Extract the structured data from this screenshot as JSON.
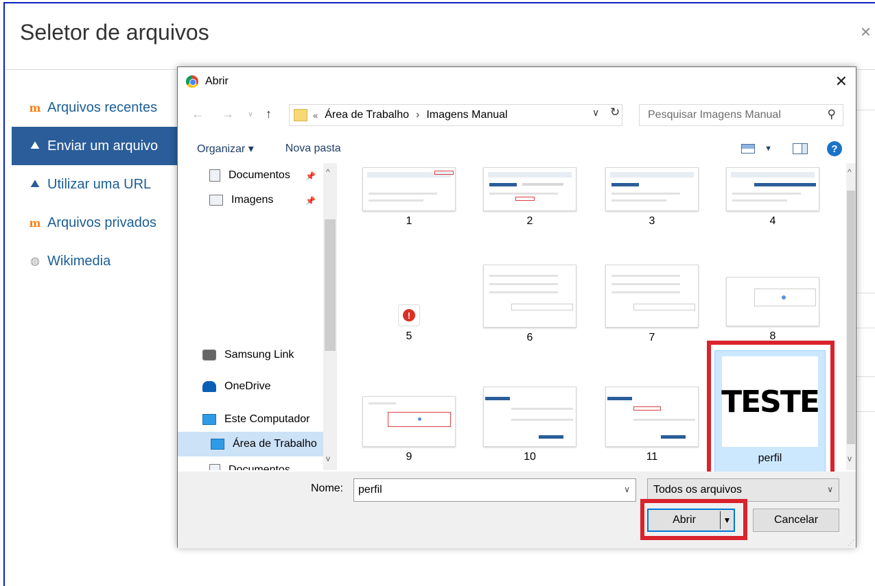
{
  "modal": {
    "title": "Seletor de arquivos",
    "close": "×"
  },
  "sidebar": {
    "items": [
      {
        "label": "Arquivos recentes",
        "icon": "moodle-icon"
      },
      {
        "label": "Enviar um arquivo",
        "icon": "upload-icon",
        "active": true
      },
      {
        "label": "Utilizar uma URL",
        "icon": "url-icon"
      },
      {
        "label": "Arquivos privados",
        "icon": "moodle-icon"
      },
      {
        "label": "Wikimedia",
        "icon": "wikimedia-icon"
      }
    ]
  },
  "dialog": {
    "title": "Abrir",
    "close": "✕",
    "path": {
      "prefix": "«",
      "crumbs": [
        "Área de Trabalho",
        "Imagens Manual"
      ],
      "separator": "›"
    },
    "search_placeholder": "Pesquisar Imagens Manual",
    "toolbar": {
      "organize": "Organizar ▾",
      "new_folder": "Nova pasta",
      "help": "?"
    },
    "nav": {
      "documents": "Documentos",
      "images": "Imagens",
      "samsung": "Samsung Link",
      "onedrive": "OneDrive",
      "computer": "Este Computador",
      "desktop": "Área de Trabalho",
      "documents2": "Documentos"
    },
    "files": [
      "1",
      "2",
      "3",
      "4",
      "5",
      "6",
      "7",
      "8",
      "9",
      "10",
      "11"
    ],
    "selected_file": {
      "thumb_text": "TESTE",
      "name": "perfil"
    },
    "name_label": "Nome:",
    "name_value": "perfil",
    "filter": "Todos os arquivos",
    "open_button": "Abrir",
    "cancel_button": "Cancelar"
  },
  "colors": {
    "frame_border": "#0a1fbf",
    "active_item": "#2a5d99",
    "highlight_red": "#d9232d",
    "selection": "#cce8ff"
  }
}
